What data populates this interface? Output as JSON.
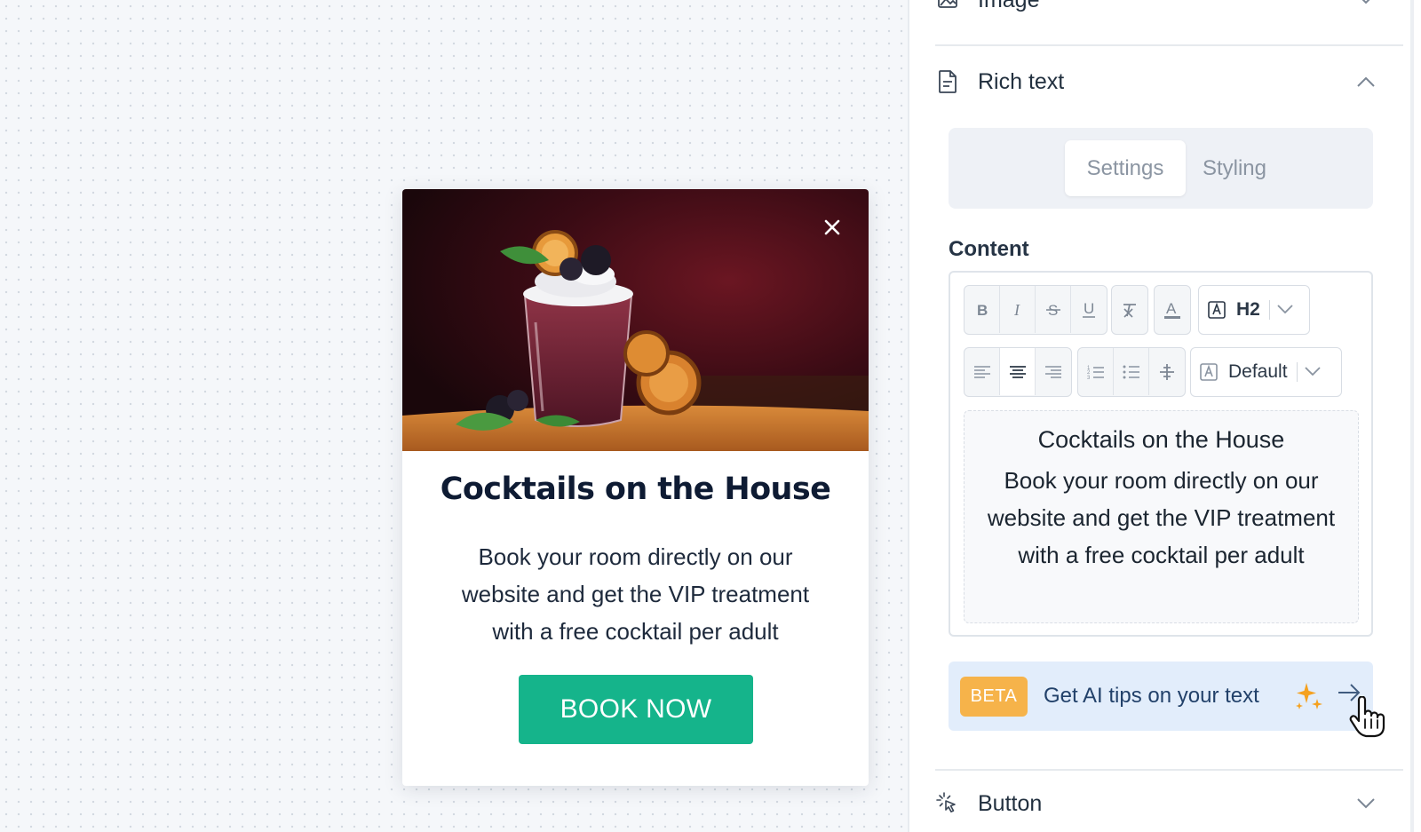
{
  "popup": {
    "title": "Cocktails on the House",
    "body": "Book your room directly on our website and get the VIP treatment with a free cocktail per adult",
    "button_label": "BOOK NOW",
    "close_icon": "close-icon",
    "image_alt": "cocktail-photo"
  },
  "panel": {
    "image_section": {
      "label": "Image",
      "icon": "image-icon"
    },
    "rich_text_section": {
      "label": "Rich text",
      "icon": "document-icon"
    },
    "tabs": [
      {
        "label": "Settings",
        "active": true
      },
      {
        "label": "Styling",
        "active": false
      }
    ],
    "content_label": "Content",
    "toolbar": {
      "format_buttons": [
        "bold-icon",
        "italic-icon",
        "strikethrough-icon",
        "underline-icon"
      ],
      "clear_format": "clear-format-icon",
      "text_color": "text-color-icon",
      "heading_select": "H2",
      "align_buttons": [
        "align-left-icon",
        "align-center-icon",
        "align-right-icon"
      ],
      "list_buttons": [
        "ordered-list-icon",
        "bullet-list-icon",
        "line-height-icon"
      ],
      "font_select": "Default"
    },
    "editor_text": {
      "heading": "Cocktails on the House",
      "body": "Book your room directly on our website and get the VIP treatment with a free cocktail per adult"
    },
    "ai_tips": {
      "badge": "BETA",
      "label": "Get AI tips on your text"
    },
    "button_section": {
      "label": "Button",
      "icon": "cursor-click-icon"
    }
  },
  "colors": {
    "brand_green": "#15b48b",
    "beta_orange": "#f6b34a",
    "ai_bar_bg": "#e2edfb",
    "title_navy": "#0e1b33"
  }
}
